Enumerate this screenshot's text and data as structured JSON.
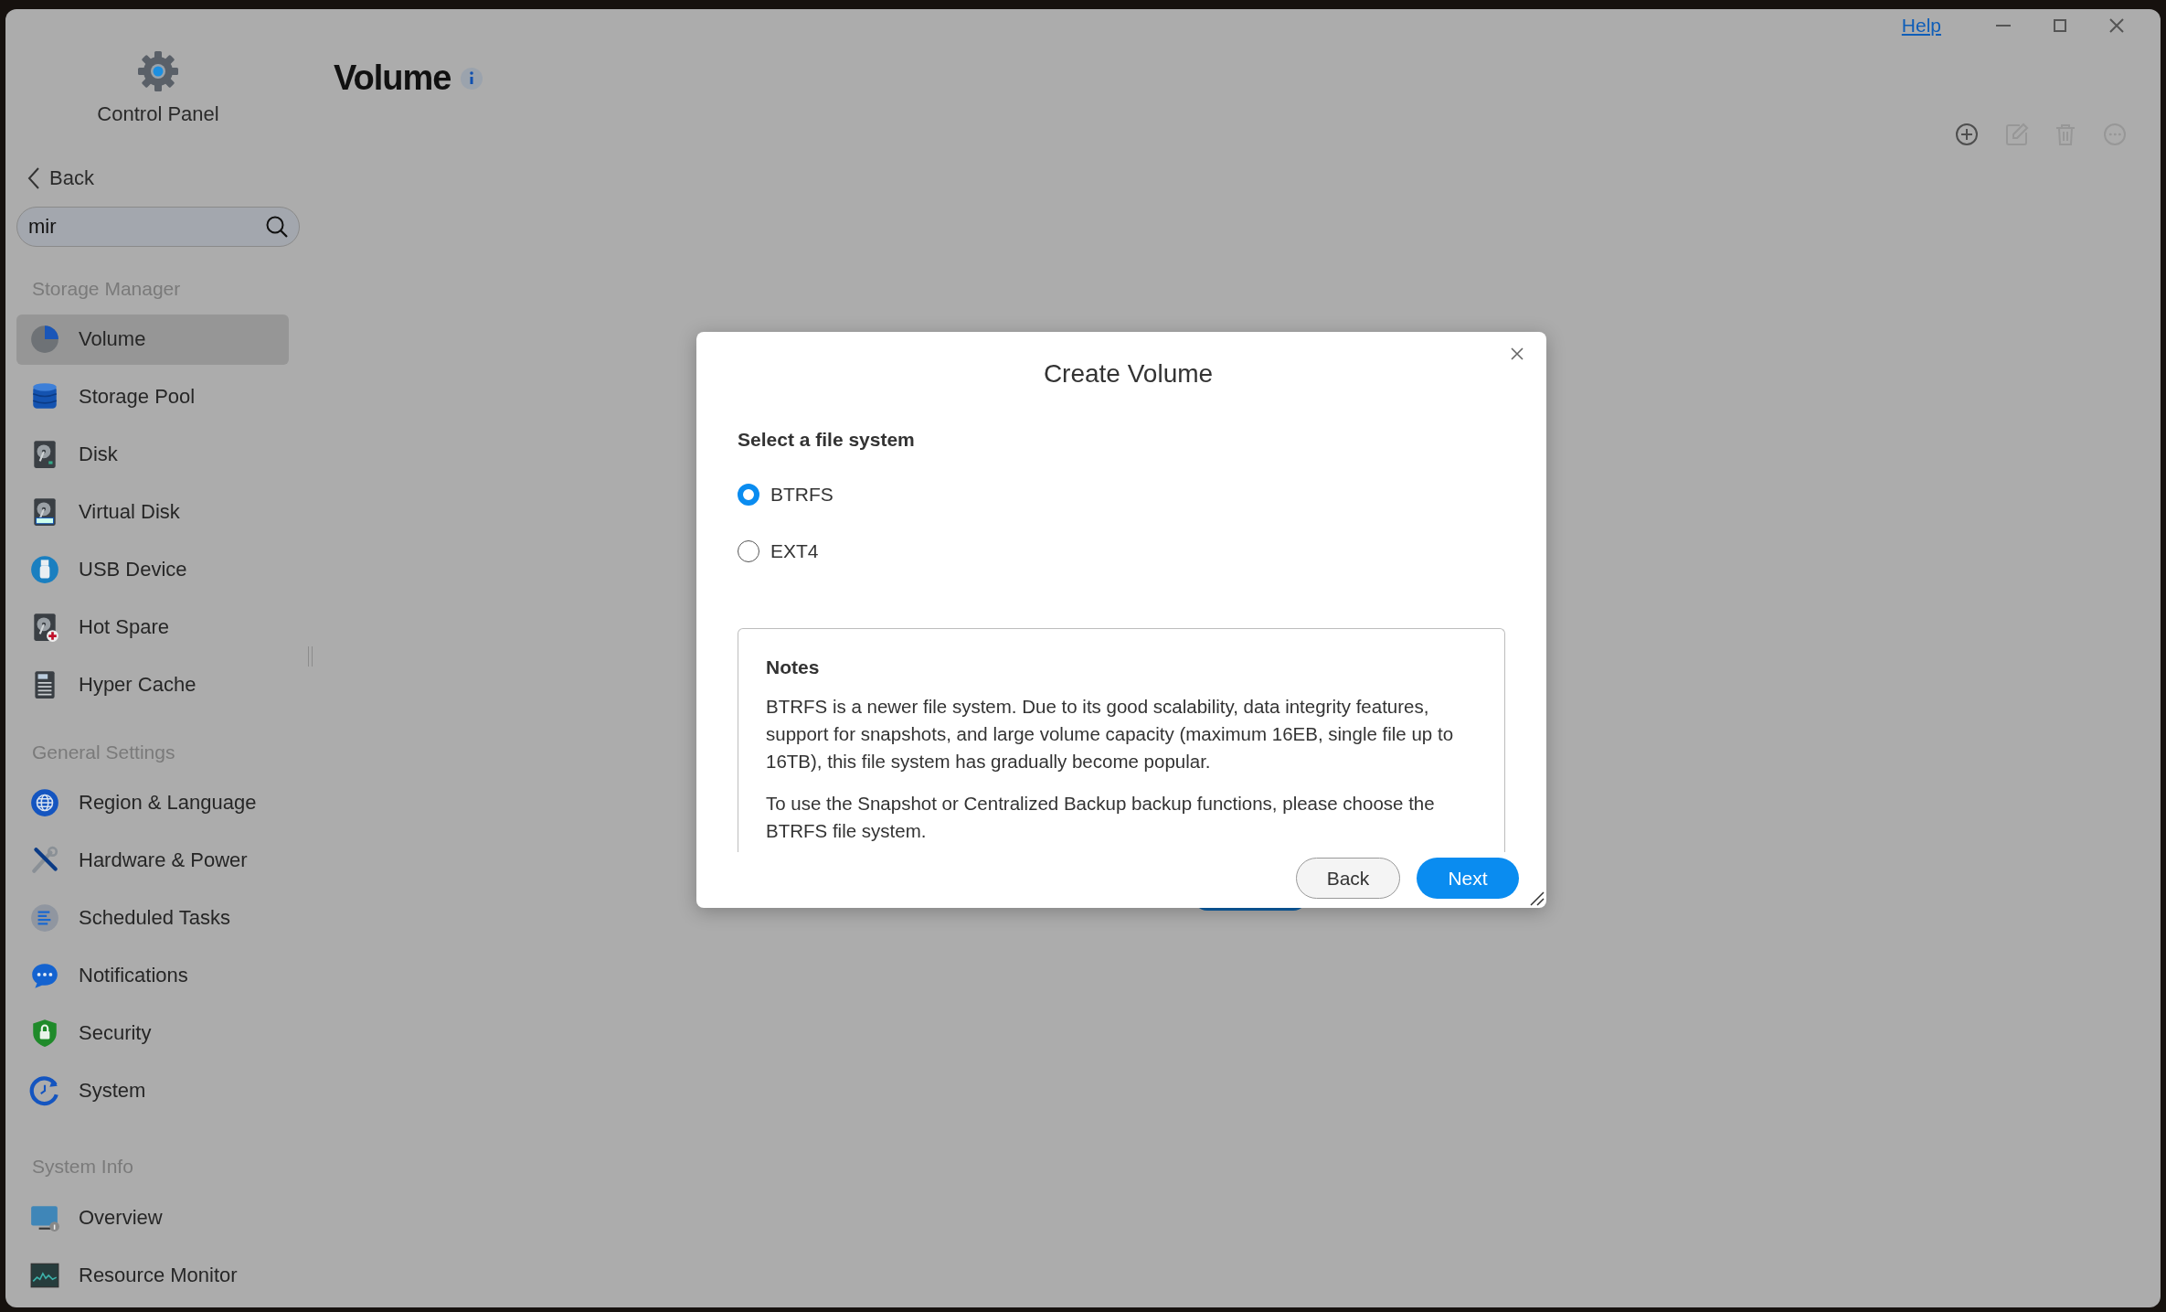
{
  "window": {
    "help_link": "Help"
  },
  "sidebar": {
    "app_title": "Control Panel",
    "back": "Back",
    "search": {
      "value": "mir"
    },
    "groups": [
      {
        "heading": "Storage Manager",
        "items": [
          {
            "label": "Volume",
            "selected": true
          },
          {
            "label": "Storage Pool",
            "selected": false
          },
          {
            "label": "Disk",
            "selected": false
          },
          {
            "label": "Virtual Disk",
            "selected": false
          },
          {
            "label": "USB Device",
            "selected": false
          },
          {
            "label": "Hot Spare",
            "selected": false
          },
          {
            "label": "Hyper Cache",
            "selected": false
          }
        ]
      },
      {
        "heading": "General Settings",
        "items": [
          {
            "label": "Region & Language",
            "selected": false
          },
          {
            "label": "Hardware & Power",
            "selected": false
          },
          {
            "label": "Scheduled Tasks",
            "selected": false
          },
          {
            "label": "Notifications",
            "selected": false
          },
          {
            "label": "Security",
            "selected": false
          },
          {
            "label": "System",
            "selected": false
          }
        ]
      },
      {
        "heading": "System Info",
        "items": [
          {
            "label": "Overview",
            "selected": false
          },
          {
            "label": "Resource Monitor",
            "selected": false
          }
        ]
      }
    ]
  },
  "page": {
    "title": "Volume",
    "toolbar": [
      {
        "disabled": false
      },
      {
        "disabled": true
      },
      {
        "disabled": true
      },
      {
        "disabled": true
      }
    ]
  },
  "dialog": {
    "title": "Create Volume",
    "prompt": "Select a file system",
    "options": [
      {
        "label": "BTRFS",
        "selected": true
      },
      {
        "label": "EXT4",
        "selected": false
      }
    ],
    "notes": {
      "heading": "Notes",
      "paragraphs": [
        "BTRFS is a newer file system. Due to its good scalability, data integrity features, support for snapshots, and large volume capacity (maximum 16EB, single file up to 16TB), this file system has gradually become popular.",
        "To use the Snapshot or Centralized Backup backup functions, please choose the BTRFS file system."
      ]
    },
    "buttons": [
      {
        "label": "Back",
        "kind": "secondary"
      },
      {
        "label": "Next",
        "kind": "primary"
      }
    ]
  }
}
